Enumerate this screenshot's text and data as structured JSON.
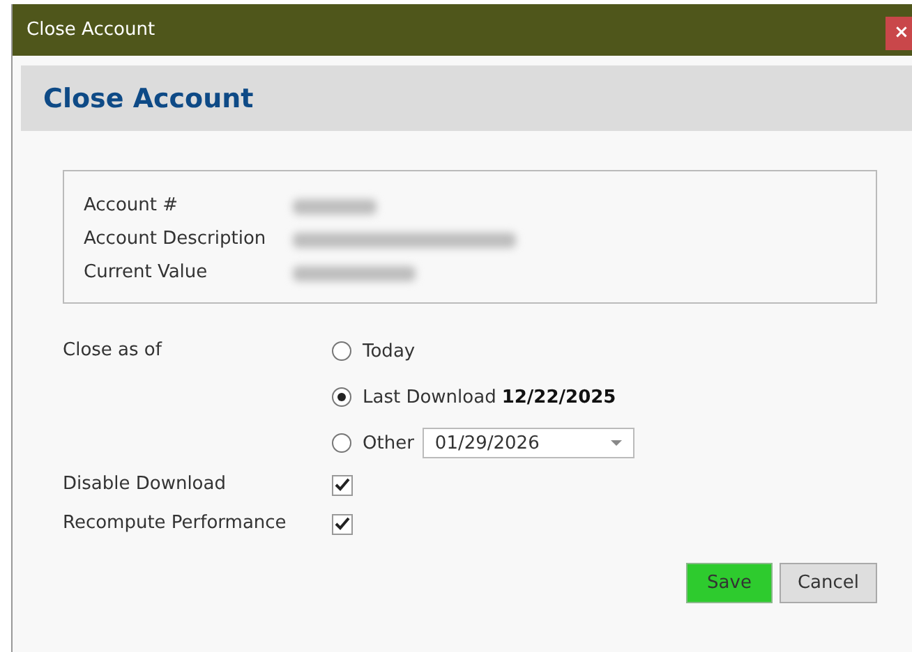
{
  "window": {
    "title": "Close Account",
    "close_button": "×"
  },
  "header": {
    "title": "Close Account"
  },
  "account_info": [
    {
      "label": "Account #"
    },
    {
      "label": "Account Description"
    },
    {
      "label": "Current Value"
    }
  ],
  "close_as_of": {
    "label": "Close as of",
    "options": [
      {
        "kind": "plain",
        "label": "Today",
        "selected": false
      },
      {
        "kind": "bold-date",
        "label": "Last Download",
        "date": "12/22/2025",
        "selected": true
      },
      {
        "kind": "date-picker",
        "label": "Other",
        "value": "01/29/2026",
        "selected": false
      }
    ]
  },
  "checkboxes": [
    {
      "label": "Disable Download",
      "checked": true
    },
    {
      "label": "Recompute Performance",
      "checked": true
    }
  ],
  "buttons": [
    {
      "kind": "primary",
      "label": "Save"
    },
    {
      "kind": "secondary",
      "label": "Cancel"
    }
  ]
}
